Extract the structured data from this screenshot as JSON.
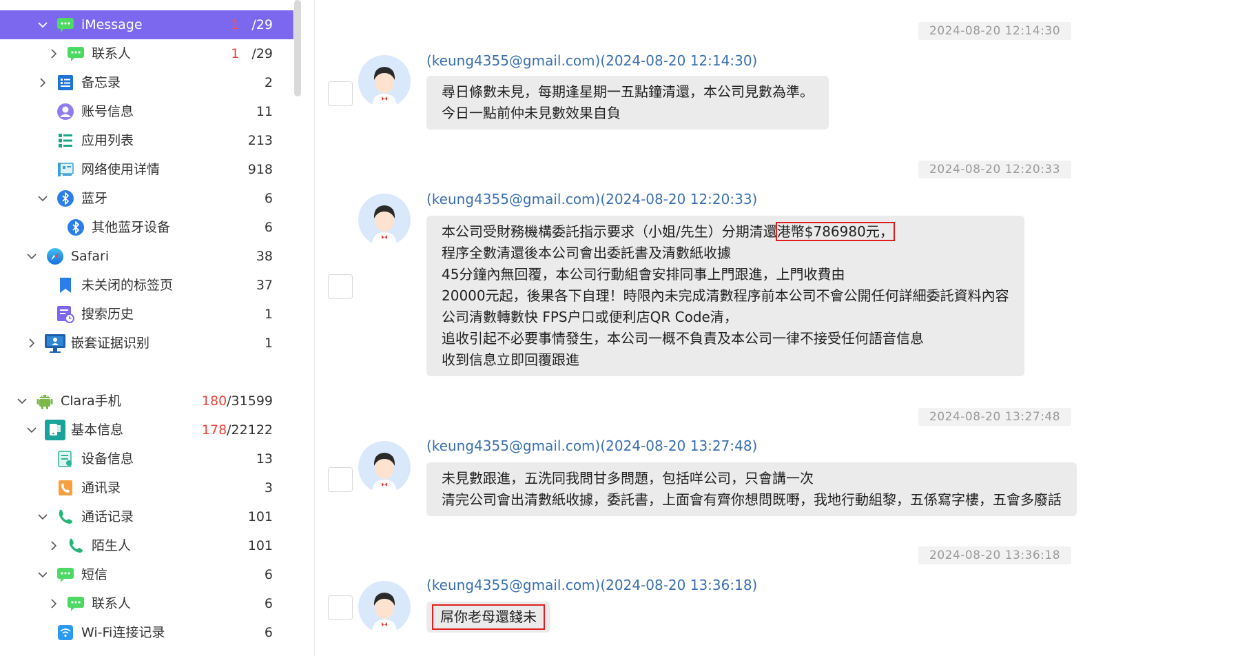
{
  "sidebar": {
    "items": [
      {
        "label": "iMessage",
        "unread": "1",
        "total": "/29"
      },
      {
        "label": "联系人",
        "unread": "1",
        "total": "/29"
      },
      {
        "label": "备忘录",
        "unread": "",
        "total": "2"
      },
      {
        "label": "账号信息",
        "unread": "",
        "total": "11"
      },
      {
        "label": "应用列表",
        "unread": "",
        "total": "213"
      },
      {
        "label": "网络使用详情",
        "unread": "",
        "total": "918"
      },
      {
        "label": "蓝牙",
        "unread": "",
        "total": "6"
      },
      {
        "label": "其他蓝牙设备",
        "unread": "",
        "total": "6"
      },
      {
        "label": "Safari",
        "unread": "",
        "total": "38"
      },
      {
        "label": "未关闭的标签页",
        "unread": "",
        "total": "37"
      },
      {
        "label": "搜索历史",
        "unread": "",
        "total": "1"
      },
      {
        "label": "嵌套证据识别",
        "unread": "",
        "total": "1"
      },
      {
        "label": "Clara手机",
        "unread": "180",
        "total": "/31599"
      },
      {
        "label": "基本信息",
        "unread": "178",
        "total": "/22122"
      },
      {
        "label": "设备信息",
        "unread": "",
        "total": "13"
      },
      {
        "label": "通讯录",
        "unread": "",
        "total": "3"
      },
      {
        "label": "通话记录",
        "unread": "",
        "total": "101"
      },
      {
        "label": "陌生人",
        "unread": "",
        "total": "101"
      },
      {
        "label": "短信",
        "unread": "",
        "total": "6"
      },
      {
        "label": "联系人",
        "unread": "",
        "total": "6"
      },
      {
        "label": "Wi-Fi连接记录",
        "unread": "",
        "total": "6"
      }
    ]
  },
  "chat": {
    "messages": [
      {
        "timestamp": "2024-08-20 12:14:30",
        "sender": "(keung4355@gmail.com)(2024-08-20 12:14:30)",
        "lines": [
          "尋日條數未見，每期逢星期一五點鐘清還，本公司見數為準。",
          "今日一點前仲未見數效果自負"
        ]
      },
      {
        "timestamp": "2024-08-20 12:20:33",
        "sender": "(keung4355@gmail.com)(2024-08-20 12:20:33)",
        "line1_prefix": "本公司受財務機構委託指示要求（小姐/先生）分期清還",
        "line1_highlight": "港幣$786980元，",
        "lines": [
          "程序全數清還後本公司會出委託書及清數紙收據",
          "45分鐘內無回覆，本公司行動組會安排同事上門跟進，上門收費由",
          "20000元起，後果各下自理！時限內未完成清數程序前本公司不會公開任何詳細委託資料內容",
          "公司清數轉數快 FPS户口或便利店QR Code清，",
          "追收引起不必要事情發生，本公司一概不負責及本公司一律不接受任何語音信息",
          "收到信息立即回覆跟進"
        ]
      },
      {
        "timestamp": "2024-08-20 13:27:48",
        "sender": "(keung4355@gmail.com)(2024-08-20 13:27:48)",
        "lines": [
          "未見數跟進，五洗同我問甘多問題，包括咩公司，只會講一次",
          "清完公司會出清數紙收據，委託書，上面會有齊你想問既嘢，我地行動組黎，五係寫字樓，五會多廢話"
        ]
      },
      {
        "timestamp": "2024-08-20 13:36:18",
        "sender": "(keung4355@gmail.com)(2024-08-20 13:36:18)",
        "highlight": "屌你老母還錢未"
      }
    ]
  },
  "colors": {
    "accent": "#7b68ee",
    "unread": "#e8453c",
    "sender": "#3a6fb0",
    "highlight_box": "#e01e1e",
    "bubble": "#ebebeb"
  },
  "icons": [
    "chevron-down-icon",
    "chevron-right-icon",
    "message-icon",
    "notes-icon",
    "account-icon",
    "app-list-icon",
    "network-icon",
    "bluetooth-icon",
    "safari-icon",
    "bookmark-icon",
    "search-history-icon",
    "monitor-icon",
    "android-icon",
    "info-icon",
    "device-info-icon",
    "contacts-icon",
    "phone-icon",
    "wifi-icon",
    "user-avatar-icon"
  ]
}
